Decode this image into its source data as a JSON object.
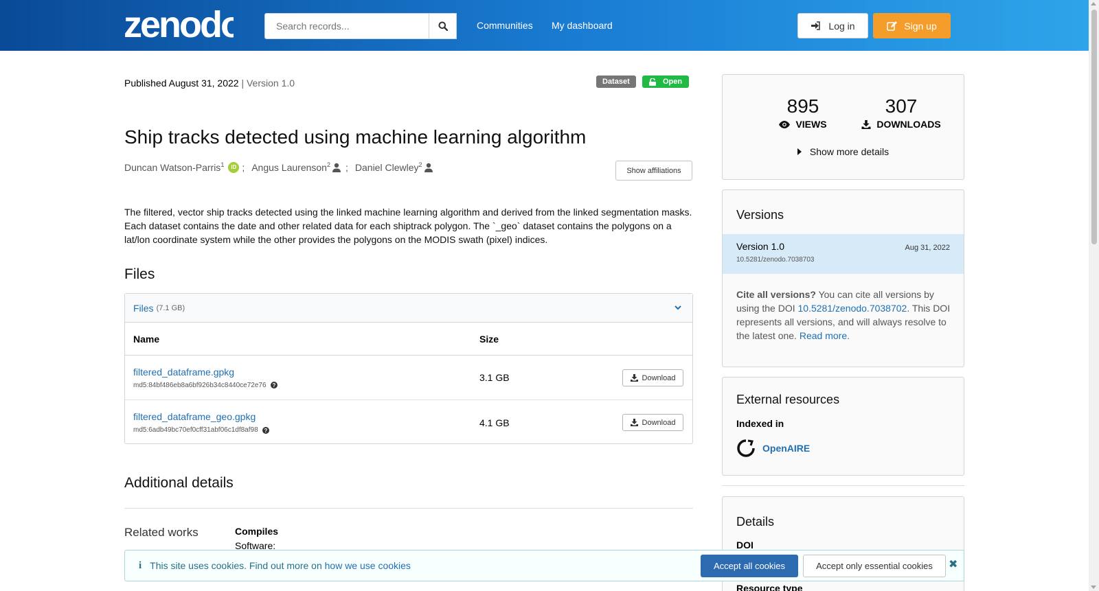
{
  "header": {
    "logo_text": "zenodo",
    "search_placeholder": "Search records...",
    "nav": [
      "Communities",
      "My dashboard"
    ],
    "login_label": "Log in",
    "signup_label": "Sign up"
  },
  "record": {
    "published": "Published August 31, 2022",
    "version_sep": " | Version 1.0",
    "badges": {
      "type": "Dataset",
      "access": "Open"
    },
    "title": "Ship tracks detected using machine learning algorithm",
    "authors": [
      {
        "name": "Duncan Watson-Parris",
        "aff": "1",
        "icon": "orcid-icon"
      },
      {
        "name": "Angus Laurenson",
        "aff": "2",
        "icon": "user-icon"
      },
      {
        "name": "Daniel Clewley",
        "aff": "2",
        "icon": "user-icon"
      }
    ],
    "show_affiliations": "Show affiliations",
    "description": "The filtered, vector ship tracks detected using the linked machine learning algorithm and derived from the linked segmentation masks. Each dataset contains the date and other related data for each shiptrack polygon. The `_geo` dataset contains the polygons on a lat/lon coordinate system while the other provides the polygons on the MODIS swath (pixel) indices."
  },
  "files": {
    "heading": "Files",
    "panel_label": "Files",
    "panel_size": "(7.1 GB)",
    "columns": [
      "Name",
      "Size"
    ],
    "rows": [
      {
        "name": "filtered_dataframe.gpkg",
        "md5": "md5:84bf486eb8a6bf926b34c8440ce72e76",
        "size": "3.1 GB",
        "action": "Download"
      },
      {
        "name": "filtered_dataframe_geo.gpkg",
        "md5": "md5:6adb49bc70ef0cff31abf06c1df8af98",
        "size": "4.1 GB",
        "action": "Download"
      }
    ]
  },
  "additional": {
    "heading": "Additional details",
    "related_works": "Related works",
    "compiles": "Compiles",
    "software": "Software:"
  },
  "sidebar": {
    "views": "895",
    "views_label": "VIEWS",
    "downloads": "307",
    "downloads_label": "DOWNLOADS",
    "more_details": "Show more details",
    "versions_heading": "Versions",
    "version_label": "Version 1.0",
    "version_date": "Aug 31, 2022",
    "version_doi": "10.5281/zenodo.7038703",
    "cite_bold": "Cite all versions?",
    "cite_text1": " You can cite all versions by using the DOI ",
    "cite_doi": "10.5281/zenodo.7038702",
    "cite_text2": ". This DOI represents all versions, and will always resolve to the latest one. ",
    "cite_read_more": "Read more.",
    "external_heading": "External resources",
    "indexed_in": "Indexed in",
    "openaire": "OpenAIRE",
    "details_heading": "Details",
    "doi_label": "DOI",
    "resource_type_label": "Resource type"
  },
  "cookie": {
    "text": "This site uses cookies. Find out more on ",
    "link": "how we use cookies",
    "accept_all": "Accept all cookies",
    "accept_essential": "Accept only essential cookies"
  },
  "colors": {
    "header_start": "#0a4a97",
    "header_end": "#2ea4ea",
    "signup": "#f59d2b",
    "open_badge": "#21ba45",
    "link": "#1f6fb2",
    "version_highlight": "#d6eaf8"
  }
}
